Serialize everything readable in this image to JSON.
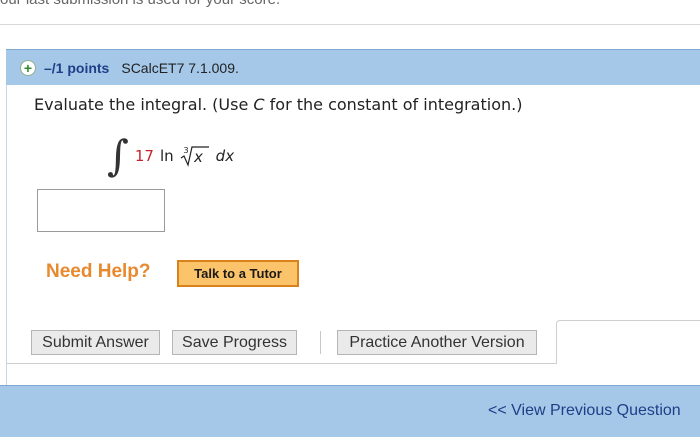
{
  "notice": {
    "text": "our last submission is used for your score."
  },
  "question": {
    "points": "–/1 points",
    "reference": "SCalcET7 7.1.009.",
    "prompt_before": "Evaluate the integral. (Use ",
    "prompt_var": "C",
    "prompt_after": " for the constant of integration.)",
    "expression": {
      "integral_sign": "∫",
      "coefficient": "17",
      "function": "ln",
      "root_index": "3",
      "radicand": "x",
      "differential": "dx"
    },
    "answer": {
      "value": "",
      "placeholder": ""
    }
  },
  "help": {
    "label": "Need Help?",
    "tutor_button": "Talk to a Tutor"
  },
  "actions": {
    "submit": "Submit Answer",
    "save": "Save Progress",
    "practice": "Practice Another Version"
  },
  "footer": {
    "prev_link": "<< View Previous Question"
  },
  "colors": {
    "header_bar": "#a5c8e8",
    "points_text": "#1d3f87",
    "help_text": "#e8892e",
    "tutor_button": "#fbc36a",
    "coefficient": "#c0272d"
  },
  "icons": {
    "expand": "plus-circle-icon"
  }
}
